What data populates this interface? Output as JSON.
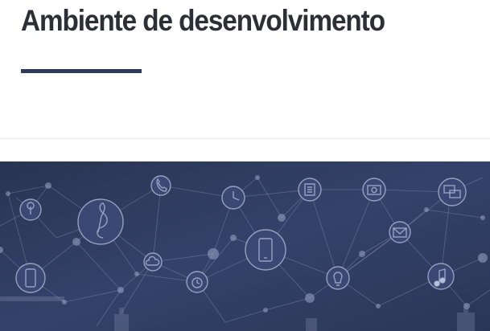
{
  "header": {
    "title": "Ambiente de desenvolvimento"
  },
  "colors": {
    "title_text": "#2c2f36",
    "accent_bar": "#2f3a5c",
    "hero_background": "#2c3858",
    "network_lines": "#8a96b8"
  },
  "hero": {
    "icons": [
      "map-pin-icon",
      "treble-clef-icon",
      "phone-icon",
      "clock-icon",
      "document-icon",
      "camera-icon",
      "chat-bubbles-icon",
      "envelope-icon",
      "smartphone-icon",
      "mobile-phone-icon",
      "cloud-icon",
      "alarm-clock-icon",
      "light-bulb-icon",
      "music-note-icon"
    ]
  }
}
